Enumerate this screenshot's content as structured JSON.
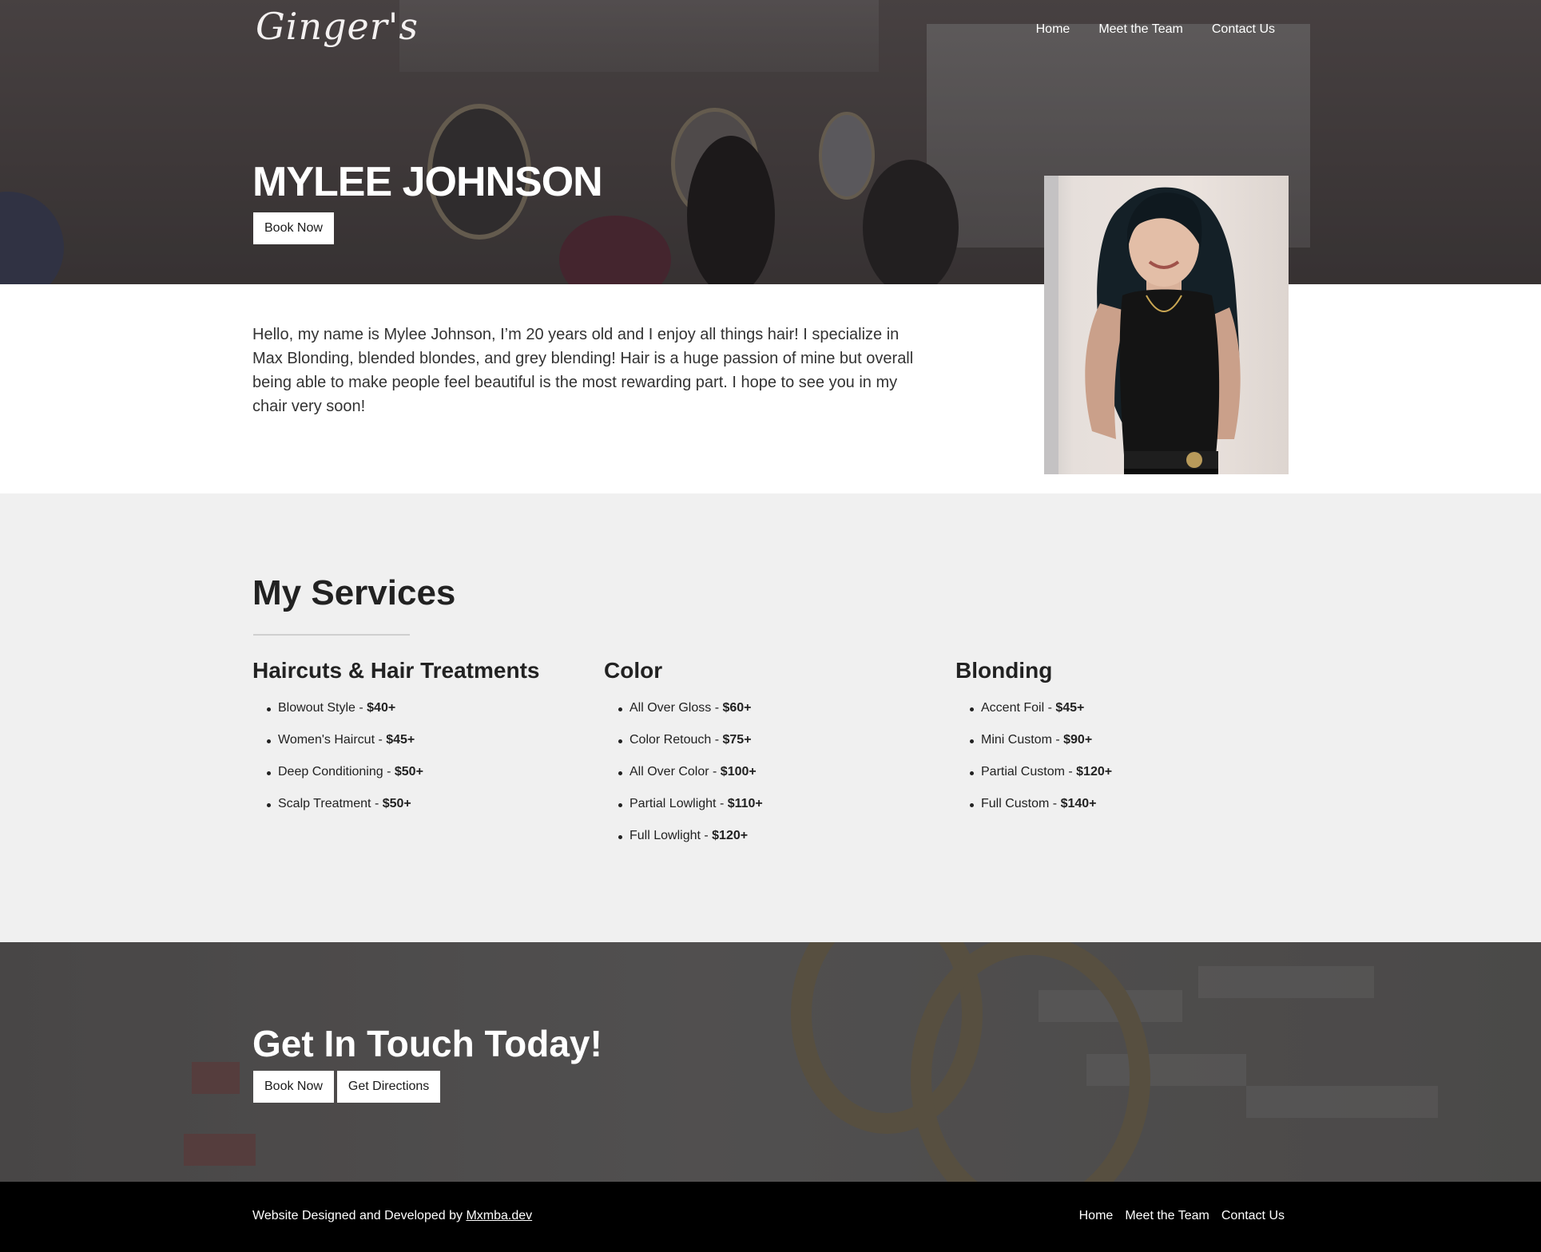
{
  "header": {
    "logo": "Ginger's",
    "nav": [
      "Home",
      "Meet the Team",
      "Contact Us"
    ]
  },
  "hero": {
    "title": "MYLEE JOHNSON",
    "book_label": "Book Now"
  },
  "intro": {
    "text": "Hello, my name is Mylee Johnson, I’m 20 years old and I enjoy all things hair! I specialize in Max Blonding, blended blondes, and grey blending! Hair is a huge passion of mine but overall being able to make people feel beautiful is the most rewarding part. I hope to see you in my chair very soon!"
  },
  "services": {
    "title": "My Services",
    "columns": [
      {
        "heading": "Haircuts & Hair Treatments",
        "items": [
          {
            "name": "Blowout Style - ",
            "price": "$40+"
          },
          {
            "name": "Women's Haircut - ",
            "price": "$45+"
          },
          {
            "name": "Deep Conditioning - ",
            "price": "$50+"
          },
          {
            "name": "Scalp Treatment - ",
            "price": "$50+"
          }
        ]
      },
      {
        "heading": "Color",
        "items": [
          {
            "name": "All Over Gloss - ",
            "price": "$60+"
          },
          {
            "name": "Color Retouch - ",
            "price": "$75+"
          },
          {
            "name": "All Over Color - ",
            "price": "$100+"
          },
          {
            "name": "Partial Lowlight - ",
            "price": "$110+"
          },
          {
            "name": "Full Lowlight - ",
            "price": "$120+"
          }
        ]
      },
      {
        "heading": "Blonding",
        "items": [
          {
            "name": "Accent Foil - ",
            "price": "$45+"
          },
          {
            "name": "Mini Custom - ",
            "price": "$90+"
          },
          {
            "name": "Partial Custom - ",
            "price": "$120+"
          },
          {
            "name": "Full Custom - ",
            "price": "$140+"
          }
        ]
      }
    ]
  },
  "contact": {
    "title": "Get In Touch Today!",
    "book_label": "Book Now",
    "directions_label": "Get Directions"
  },
  "footer": {
    "credit_prefix": "Website Designed and Developed by ",
    "credit_link": "Mxmba.dev",
    "nav": [
      "Home",
      "Meet the Team",
      "Contact Us"
    ]
  },
  "colors": {
    "services_bg": "#f0f0f0",
    "footer_bg": "#000000",
    "button_bg": "#ffffff"
  }
}
